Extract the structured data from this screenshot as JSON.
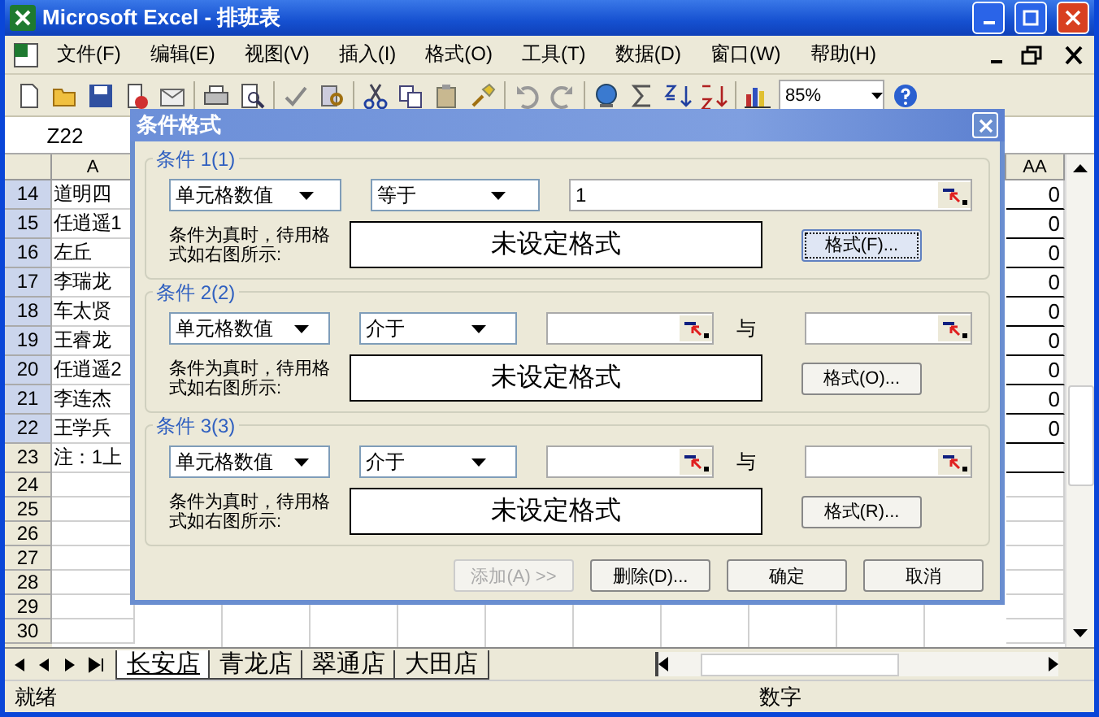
{
  "window": {
    "title": "Microsoft Excel - 排班表"
  },
  "menu": [
    "文件(F)",
    "编辑(E)",
    "视图(V)",
    "插入(I)",
    "格式(O)",
    "工具(T)",
    "数据(D)",
    "窗口(W)",
    "帮助(H)"
  ],
  "toolbar": {
    "zoom": "85%"
  },
  "name_box": "Z22",
  "columns": [
    "A",
    "AA"
  ],
  "rows": [
    {
      "num": "14",
      "a": "道明四",
      "aa": "0"
    },
    {
      "num": "15",
      "a": "任逍遥1",
      "aa": "0"
    },
    {
      "num": "16",
      "a": "左丘",
      "aa": "0"
    },
    {
      "num": "17",
      "a": "李瑞龙",
      "aa": "0"
    },
    {
      "num": "18",
      "a": "车太贤",
      "aa": "0"
    },
    {
      "num": "19",
      "a": "王睿龙",
      "aa": "0"
    },
    {
      "num": "20",
      "a": "任逍遥2",
      "aa": "0"
    },
    {
      "num": "21",
      "a": "李连杰",
      "aa": "0"
    },
    {
      "num": "22",
      "a": "王学兵",
      "aa": "0"
    },
    {
      "num": "23",
      "a": "注：1上"
    },
    {
      "num": "24"
    },
    {
      "num": "25"
    },
    {
      "num": "26"
    },
    {
      "num": "27"
    },
    {
      "num": "28"
    },
    {
      "num": "29"
    },
    {
      "num": "30"
    }
  ],
  "sheet_tabs": [
    {
      "label": "长安店",
      "selected": true
    },
    {
      "label": "青龙店",
      "selected": false
    },
    {
      "label": "翠通店",
      "selected": false
    },
    {
      "label": "大田店",
      "selected": false
    }
  ],
  "status_bar": {
    "left": "就绪",
    "mode": "数字"
  },
  "dialog": {
    "title": "条件格式",
    "conditions": [
      {
        "label": "条件 1(1)",
        "kind": "single",
        "type": "单元格数值",
        "operator": "等于",
        "value": "1",
        "hint": "条件为真时，待用格式如右图所示:",
        "preview": "未设定格式",
        "button": "格式(F)...",
        "focused": true
      },
      {
        "label": "条件 2(2)",
        "kind": "between",
        "type": "单元格数值",
        "operator": "介于",
        "joiner": "与",
        "hint": "条件为真时，待用格式如右图所示:",
        "preview": "未设定格式",
        "button": "格式(O)...",
        "focused": false
      },
      {
        "label": "条件 3(3)",
        "kind": "between",
        "type": "单元格数值",
        "operator": "介于",
        "joiner": "与",
        "hint": "条件为真时，待用格式如右图所示:",
        "preview": "未设定格式",
        "button": "格式(R)...",
        "focused": false
      }
    ],
    "buttons": [
      {
        "label": "添加(A) >>",
        "disabled": true
      },
      {
        "label": "删除(D)...",
        "disabled": false
      },
      {
        "label": "确定",
        "disabled": false
      },
      {
        "label": "取消",
        "disabled": false
      }
    ]
  }
}
